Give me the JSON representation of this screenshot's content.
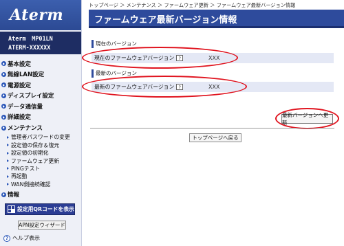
{
  "logo": "Aterm",
  "model": {
    "line1": "Aterm　MP01LN",
    "line2": "ATERM-XXXXXX"
  },
  "nav": [
    {
      "label": "基本設定"
    },
    {
      "label": "無線LAN設定"
    },
    {
      "label": "電源設定"
    },
    {
      "label": "ディスプレイ設定"
    },
    {
      "label": "データ通信量"
    },
    {
      "label": "詳細設定"
    },
    {
      "label": "メンテナンス"
    }
  ],
  "maintenance_sub": [
    "管理者パスワードの変更",
    "設定値の保存＆復元",
    "設定値の初期化",
    "ファームウェア更新",
    "PINGテスト",
    "再起動",
    "WAN側接続確認"
  ],
  "info_label": "情報",
  "qr_button": "設定用QRコードを表示",
  "apn_button": "APN設定ウィザード",
  "help_label": "ヘルプ表示",
  "help_icon_glyph": "?",
  "breadcrumb": "トップページ ＞ メンテナンス ＞ ファームウェア更新 ＞ ファームウェア最新バージョン情報",
  "page_title": "ファームウェア最新バージョン情報",
  "current_section": {
    "head": "現在のバージョン",
    "label": "現在のファームウェアバージョン",
    "value": "XXX"
  },
  "latest_section": {
    "head": "最新のバージョン",
    "label": "最新のファームウェアバージョン",
    "value": "XXX"
  },
  "q_glyph": "?",
  "update_button": "最新バージョンへ更新",
  "top_button": "トップページへ戻る",
  "colors": {
    "accent": "#2e4b9c",
    "highlight": "#e0141f",
    "row_bg": "#e4e8f5"
  }
}
